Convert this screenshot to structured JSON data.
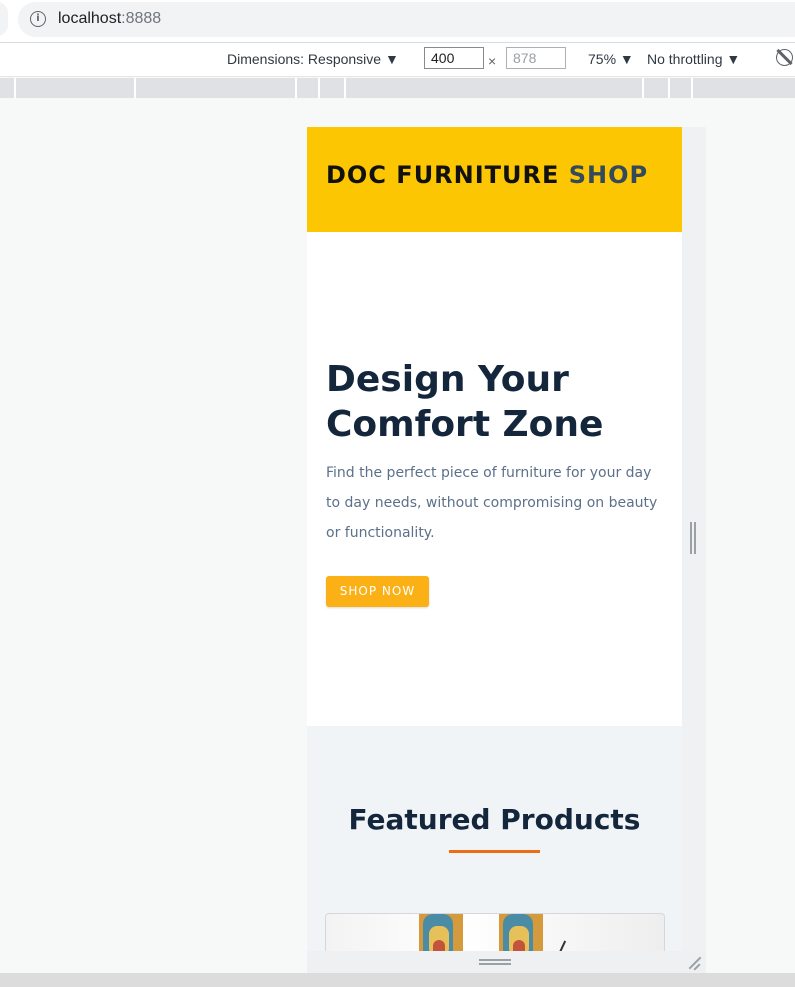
{
  "browser": {
    "url_host": "localhost",
    "url_port": ":8888"
  },
  "device_toolbar": {
    "dimensions_label": "Dimensions: Responsive ▼",
    "width_value": "400",
    "height_placeholder": "878",
    "times": "×",
    "zoom_label": "75% ▼",
    "throttle_label": "No throttling ▼"
  },
  "site": {
    "brand_main": "DOC FURNITURE",
    "brand_accent": "SHOP",
    "hero": {
      "title": "Design Your Comfort Zone",
      "description": "Find the perfect piece of furniture for your day to day needs, without compromising on beauty or functionality.",
      "cta_label": "SHOP NOW"
    },
    "featured_title": "Featured Products"
  },
  "colors": {
    "header_bg": "#fcc602",
    "brand_accent": "#33495c",
    "heading": "#13263b",
    "cta_bg": "#fbb016",
    "underline": "#ee6d14"
  },
  "icons": [
    "info-icon",
    "rotate-icon"
  ]
}
